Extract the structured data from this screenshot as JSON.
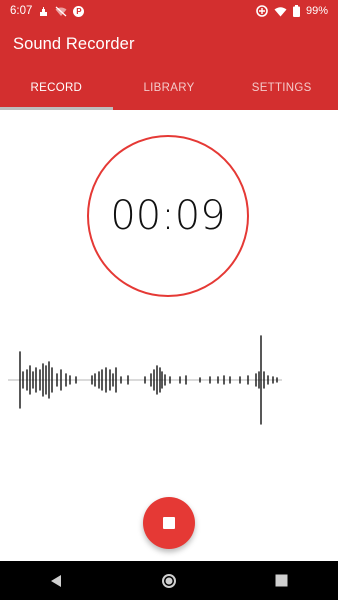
{
  "status_bar": {
    "time": "6:07",
    "left_icons": [
      "usb-debug-icon",
      "wifi-off-icon",
      "p-app-icon"
    ],
    "p_icon_letter": "P",
    "right_icons": [
      "data-saver-icon",
      "wifi-icon",
      "battery-icon"
    ],
    "battery": "99%"
  },
  "app_bar": {
    "title": "Sound Recorder"
  },
  "tabs": [
    {
      "label": "RECORD",
      "active": true
    },
    {
      "label": "LIBRARY",
      "active": false
    },
    {
      "label": "SETTINGS",
      "active": false
    }
  ],
  "timer": {
    "elapsed": "00:09"
  },
  "fab": {
    "icon": "stop-icon"
  },
  "nav_bar": {
    "icons": [
      "back-icon",
      "home-icon",
      "recents-icon"
    ]
  },
  "colors": {
    "primary": "#d32f2f",
    "accent": "#e53935",
    "tab_indicator": "#bdbdbd",
    "nav_bar": "#000000"
  }
}
